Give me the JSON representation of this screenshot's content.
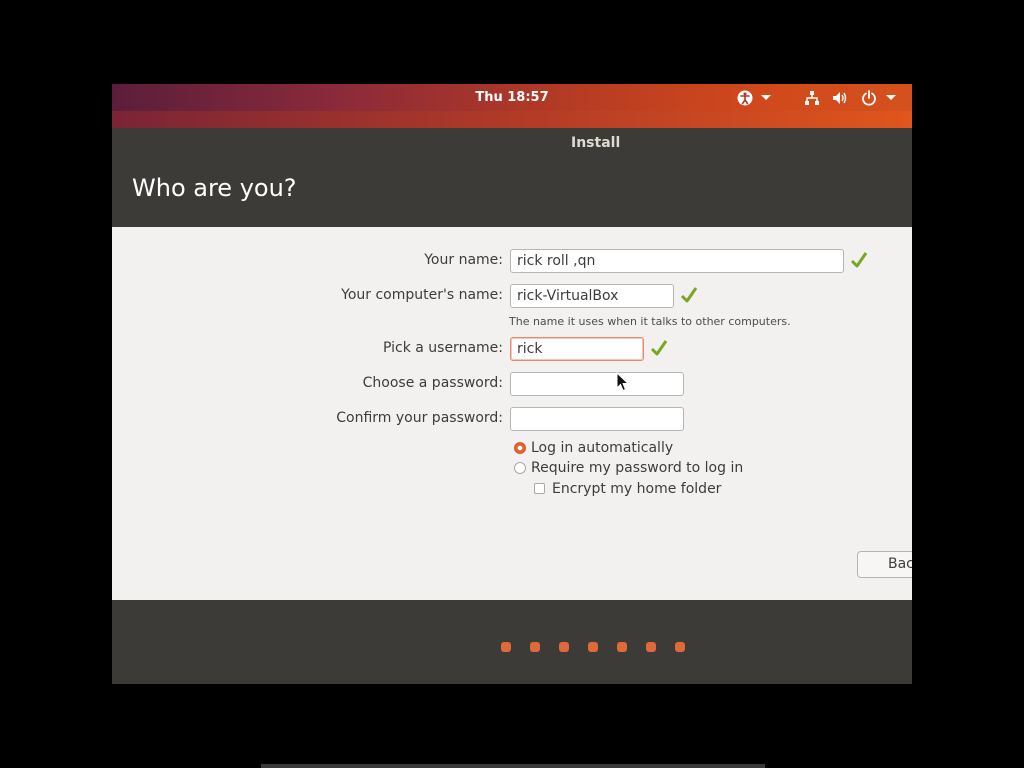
{
  "top_panel": {
    "clock": "Thu 18:57",
    "icons": [
      "accessibility-icon",
      "chevron-down-icon",
      "network-icon",
      "volume-icon",
      "power-icon",
      "chevron-down-icon"
    ],
    "accent": "#e95420"
  },
  "window": {
    "title": "Install",
    "heading": "Who are you?"
  },
  "form": {
    "name_label": "Your name:",
    "name_value": "rick roll ,qn",
    "computer_label": "Your computer's name:",
    "computer_value": "rick-VirtualBox",
    "computer_hint": "The name it uses when it talks to other computers.",
    "username_label": "Pick a username:",
    "username_value": "rick",
    "password_label": "Choose a password:",
    "password_value": "",
    "confirm_label": "Confirm your password:",
    "confirm_value": "",
    "login_auto_label": "Log in automatically",
    "login_auto_selected": true,
    "require_password_label": "Require my password to log in",
    "encrypt_label": "Encrypt my home folder",
    "encrypt_checked": false,
    "valid_icon": "check-icon",
    "valid_color": "#7aa527"
  },
  "buttons": {
    "back": "Back"
  },
  "progress": {
    "total_steps": 7,
    "dot_color": "#e0693a"
  }
}
